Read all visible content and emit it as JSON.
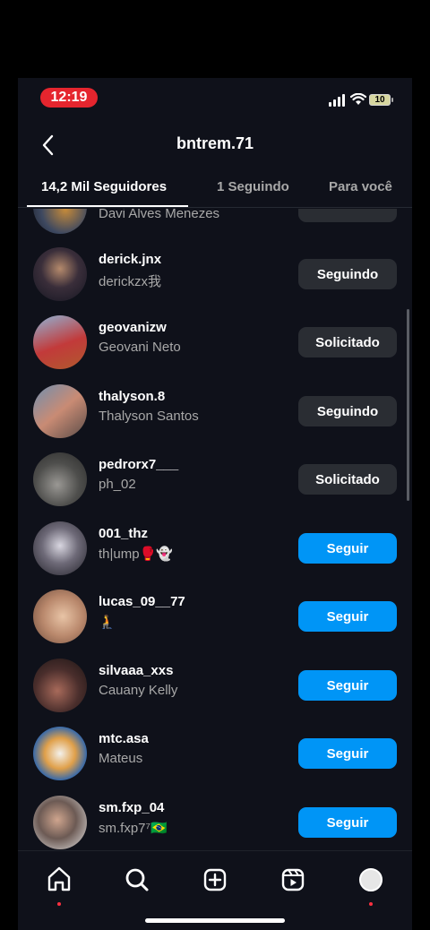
{
  "status": {
    "time": "12:19",
    "battery": "10"
  },
  "header": {
    "title": "bntrem.71"
  },
  "tabs": [
    {
      "label": "14,2 Mil Seguidores"
    },
    {
      "label": "1 Seguindo"
    },
    {
      "label": "Para você"
    }
  ],
  "partial_row": {
    "full_name": "Davi Alves Menezes"
  },
  "followers": [
    {
      "username": "derick.jnx",
      "full_name": "derickzx我",
      "button": "Seguindo",
      "button_type": "secondary"
    },
    {
      "username": "geovanizw",
      "full_name": "Geovani Neto",
      "button": "Solicitado",
      "button_type": "secondary"
    },
    {
      "username": "thalyson.8",
      "full_name": "Thalyson Santos",
      "button": "Seguindo",
      "button_type": "secondary"
    },
    {
      "username": "pedrorx7___",
      "full_name": "ph_02",
      "button": "Solicitado",
      "button_type": "secondary"
    },
    {
      "username": "001_thz",
      "full_name": "th|ump🥊👻",
      "button": "Seguir",
      "button_type": "primary"
    },
    {
      "username": "lucas_09__77",
      "full_name": "🧎",
      "button": "Seguir",
      "button_type": "primary"
    },
    {
      "username": "silvaaa_xxs",
      "full_name": "Cauany Kelly",
      "button": "Seguir",
      "button_type": "primary"
    },
    {
      "username": "mtc.asa",
      "full_name": "Mateus",
      "button": "Seguir",
      "button_type": "primary"
    },
    {
      "username": "sm.fxp_04",
      "full_name": "sm.fxp7⁷🇧🇷",
      "button": "Seguir",
      "button_type": "primary"
    }
  ],
  "colors": {
    "primary_button": "#0095f6",
    "secondary_button": "#2a2d33",
    "background": "#0f111a",
    "time_pill": "#e5252e"
  },
  "nav_icons": [
    "home-icon",
    "search-icon",
    "create-icon",
    "reels-icon",
    "profile-avatar"
  ]
}
